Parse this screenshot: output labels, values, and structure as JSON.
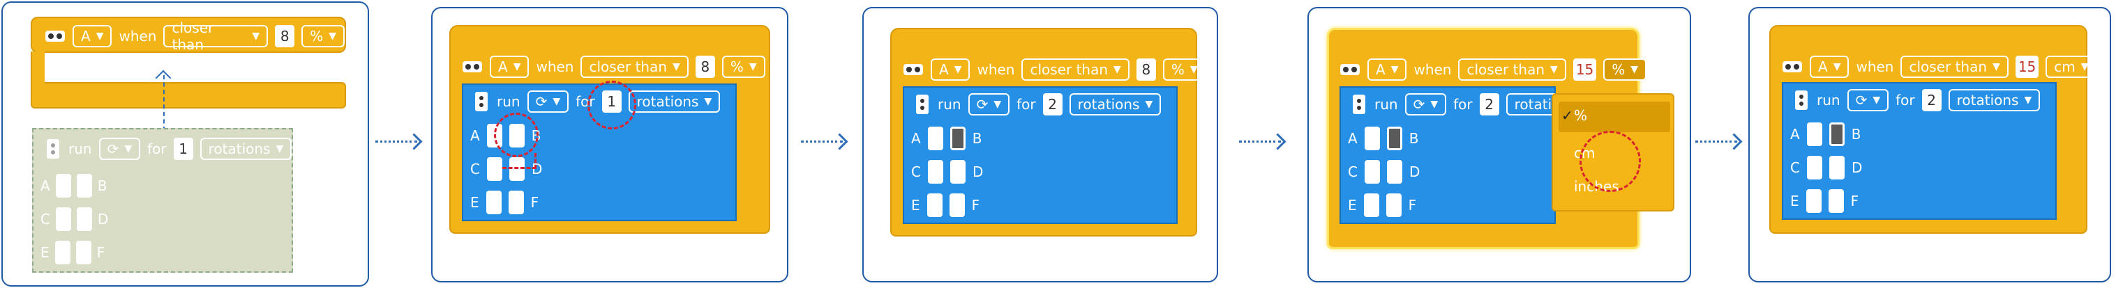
{
  "colors": {
    "event_yellow": "#f2b417",
    "run_blue": "#2590e6",
    "panel_border": "#1f5aa6",
    "highlight_red": "#d9232e"
  },
  "event": {
    "port": "A",
    "when_label": "when",
    "comparator": "closer than",
    "value_initial": "8",
    "value_final": "15",
    "unit_initial": "%",
    "unit_final": "cm"
  },
  "run": {
    "label": "run",
    "for_label": "for",
    "rotations_label": "rotations",
    "value_initial": "1",
    "value_final": "2",
    "ports": [
      "A",
      "B",
      "C",
      "D",
      "E",
      "F"
    ]
  },
  "dropdown": {
    "options": [
      "%",
      "cm",
      "inches"
    ],
    "checked": "%"
  },
  "icons": {
    "sensor": "distance-sensor-icon",
    "motor": "motor-pair-icon",
    "rotate": "rotate-icon",
    "chevron": "chevron-down-icon"
  }
}
